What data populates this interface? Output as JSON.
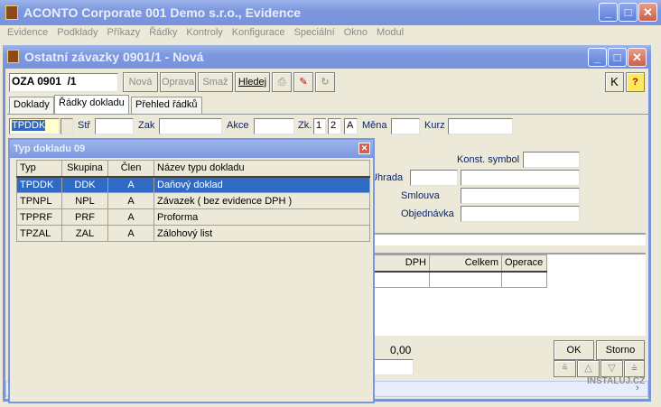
{
  "app": {
    "title": "ACONTO Corporate 001 Demo s.r.o., Evidence"
  },
  "menu": [
    "Evidence",
    "Podklady",
    "Příkazy",
    "Řádky",
    "Kontroly",
    "Konfigurace",
    "Speciální",
    "Okno",
    "Modul"
  ],
  "child": {
    "title": "Ostatní závazky 0901/1 - Nová",
    "doc_number": "OZA 0901  /1",
    "toolbar": {
      "new": "Nová",
      "edit": "Oprava",
      "delete": "Smaž",
      "search": "Hledej",
      "k": "K",
      "help": "?"
    },
    "tabs": [
      "Doklady",
      "Řádky dokladu",
      "Přehled řádků"
    ],
    "fields": {
      "type_value": "TPDDK",
      "str": "Stř",
      "zak": "Zak",
      "akce": "Akce",
      "zk": "Zk.",
      "zk1": "1",
      "zk2": "2",
      "zk3": "A",
      "mena": "Měna",
      "kurz": "Kurz"
    },
    "right": {
      "konst_symbol": "Konst. symbol",
      "uhrada": "Úhrada",
      "smlouva": "Smlouva",
      "objednavka": "Objednávka"
    },
    "table_headers": [
      "DPH",
      "Celkem",
      "Operace"
    ],
    "total": "0,00",
    "ok": "OK",
    "storno": "Storno"
  },
  "popup": {
    "title": "Typ dokladu 09",
    "headers": [
      "Typ",
      "Skupina",
      "Člen",
      "Název typu dokladu"
    ],
    "rows": [
      [
        "TPDDK",
        "DDK",
        "A",
        "Daňový doklad"
      ],
      [
        "TPNPL",
        "NPL",
        "A",
        "Závazek ( bez evidence DPH )"
      ],
      [
        "TPPRF",
        "PRF",
        "A",
        "Proforma"
      ],
      [
        "TPZAL",
        "ZAL",
        "A",
        "Zálohový list"
      ]
    ],
    "selected_row": 0
  },
  "watermark": "INSTALUJ.CZ"
}
